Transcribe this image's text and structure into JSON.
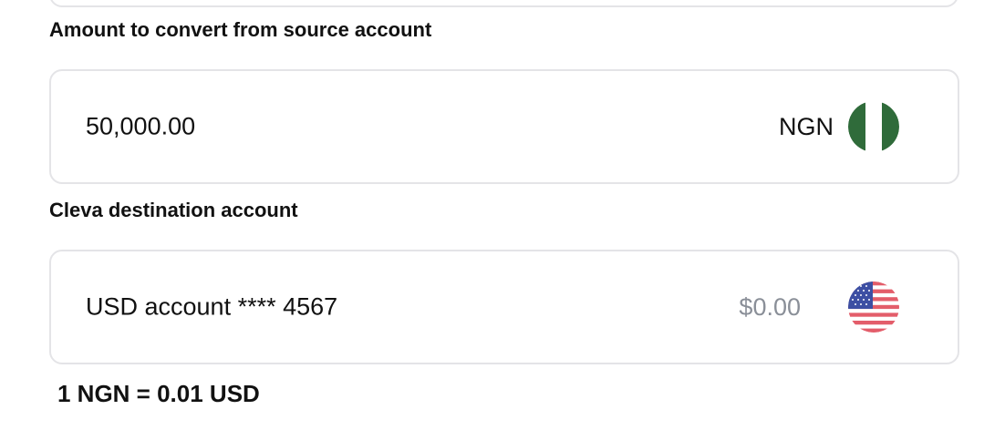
{
  "source": {
    "label": "Amount to convert from source account",
    "amount": "50,000.00",
    "currency": "NGN",
    "flag_icon": "nigeria-flag-icon"
  },
  "destination": {
    "label": "Cleva destination account",
    "account": "USD account **** 4567",
    "balance": "$0.00",
    "flag_icon": "usa-flag-icon"
  },
  "rate": {
    "text": "1 NGN = 0.01 USD"
  },
  "colors": {
    "border": "#e4e4e7",
    "muted_text": "#8a8f98",
    "nigeria_green": "#2f6b3a",
    "usa_red": "#e35d6a",
    "usa_blue": "#3d4fa3"
  }
}
